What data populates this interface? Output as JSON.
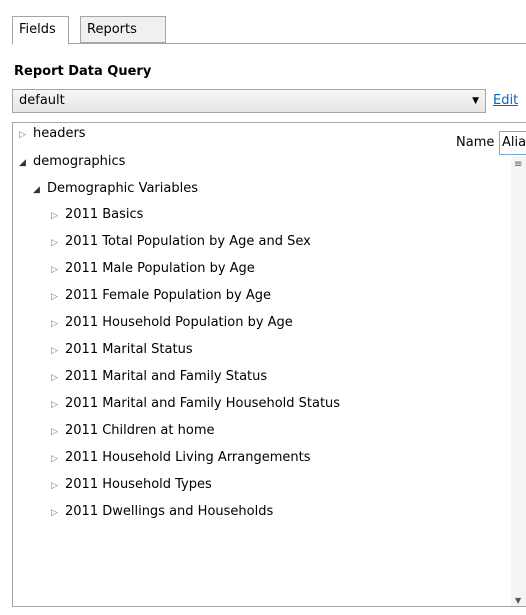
{
  "tabs": [
    {
      "label": "Fields"
    },
    {
      "label": "Reports"
    }
  ],
  "query": {
    "section_title": "Report Data Query",
    "selected": "default",
    "edit_label": "Edit"
  },
  "detail": {
    "name_label": "Name",
    "alias_value": "Alias"
  },
  "tree": {
    "nodes": [
      {
        "label": "headers",
        "expanded": false
      },
      {
        "label": "demographics",
        "expanded": true
      },
      {
        "label": "Demographic Variables",
        "expanded": true
      },
      {
        "label": "2011 Basics",
        "expanded": false
      },
      {
        "label": "2011 Total Population by Age and Sex",
        "expanded": false
      },
      {
        "label": "2011 Male Population by Age",
        "expanded": false
      },
      {
        "label": "2011 Female Population by Age",
        "expanded": false
      },
      {
        "label": "2011 Household Population by Age",
        "expanded": false
      },
      {
        "label": "2011 Marital Status",
        "expanded": false
      },
      {
        "label": "2011 Marital and Family Status",
        "expanded": false
      },
      {
        "label": "2011 Marital and Family Household Status",
        "expanded": false
      },
      {
        "label": "2011 Children at home",
        "expanded": false
      },
      {
        "label": "2011 Household Living Arrangements",
        "expanded": false
      },
      {
        "label": "2011 Household Types",
        "expanded": false
      },
      {
        "label": "2011 Dwellings and Households",
        "expanded": false
      }
    ]
  }
}
